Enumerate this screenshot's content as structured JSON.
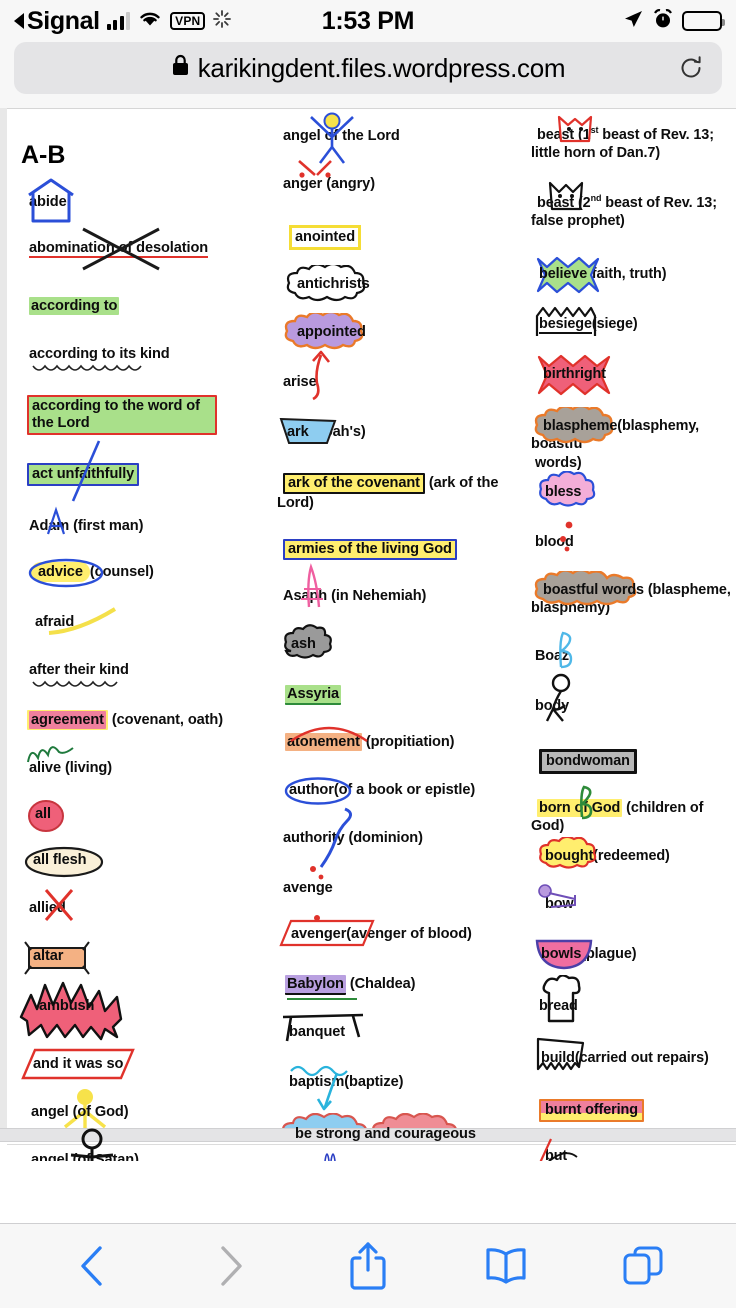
{
  "status_bar": {
    "carrier": "Signal",
    "back_arrow": "back-triangle",
    "signal_icon": "cellular-signal-icon",
    "wifi_icon": "wifi-icon",
    "vpn_badge": "VPN",
    "activity_icon": "activity-spinner-icon",
    "time": "1:53 PM",
    "location_icon": "location-arrow-icon",
    "alarm_icon": "alarm-clock-icon",
    "battery_icon": "battery-icon"
  },
  "url_bar": {
    "lock_icon": "lock-icon",
    "url": "karikingdent.files.wordpress.com",
    "reload_icon": "reload-icon"
  },
  "document": {
    "heading": "A-B",
    "columns": [
      {
        "id": "column-1",
        "entries": [
          {
            "term": "abide",
            "note": "",
            "style": "plain",
            "doodle": "house"
          },
          {
            "term": "abomination of desolation",
            "note": "",
            "style": "underline-red",
            "doodle": "x-cross"
          },
          {
            "term": "according to",
            "note": "",
            "style": "highlight-green",
            "doodle": "none"
          },
          {
            "term": "according to its kind",
            "note": "",
            "style": "squiggle-black",
            "doodle": "none"
          },
          {
            "term": "according to the word of the Lord",
            "note": "",
            "style": "highlight-green-box-red",
            "doodle": "none"
          },
          {
            "term": "act unfaithfully",
            "note": "",
            "style": "highlight-green-box-blue",
            "doodle": "blue-slash"
          },
          {
            "term": "Adam",
            "note": "(first man)",
            "style": "plain",
            "doodle": "blue-letter-a"
          },
          {
            "term": "advice",
            "note": "(counsel)",
            "style": "highlight-yellow-ellipse-blue",
            "doodle": "none"
          },
          {
            "term": "afraid",
            "note": "",
            "style": "plain",
            "doodle": "yellow-stroke"
          },
          {
            "term": "after their kind",
            "note": "",
            "style": "squiggle-black",
            "doodle": "none"
          },
          {
            "term": "agreement",
            "note": "(covenant, oath)",
            "style": "highlight-pink-box-yellow",
            "doodle": "none"
          },
          {
            "term": "alive",
            "note": "(living)",
            "style": "plain",
            "doodle": "green-squiggle"
          },
          {
            "term": "all",
            "note": "",
            "style": "blob-red",
            "doodle": "none"
          },
          {
            "term": "all flesh",
            "note": "",
            "style": "ellipse-black-cream",
            "doodle": "none"
          },
          {
            "term": "allied",
            "note": "",
            "style": "plain",
            "doodle": "red-x"
          },
          {
            "term": "altar",
            "note": "",
            "style": "highlight-orange-altar",
            "doodle": "none"
          },
          {
            "term": "ambush",
            "note": "",
            "style": "spiky-pink",
            "doodle": "none"
          },
          {
            "term": "and it was so",
            "note": "",
            "style": "parallelogram-red",
            "doodle": "none"
          },
          {
            "term": "angel (of God)",
            "note": "",
            "style": "plain",
            "doodle": "yellow-angel"
          },
          {
            "term": "angel (of Satan)",
            "note": "",
            "style": "plain",
            "doodle": "black-stickfigure"
          }
        ]
      },
      {
        "id": "column-2",
        "entries": [
          {
            "term": "angel of the Lord",
            "note": "",
            "style": "plain",
            "doodle": "blue-angel-stickfigure"
          },
          {
            "term": "anger (angry)",
            "note": "",
            "style": "plain",
            "doodle": "red-angry-brows"
          },
          {
            "term": "anointed",
            "note": "",
            "style": "box-yellow",
            "doodle": "none"
          },
          {
            "term": "antichrists",
            "note": "",
            "style": "cloud-black",
            "doodle": "none"
          },
          {
            "term": "appointed",
            "note": "",
            "style": "cloud-purple-orange",
            "doodle": "none"
          },
          {
            "term": "arise",
            "note": "",
            "style": "plain",
            "doodle": "red-up-arrow"
          },
          {
            "term": "ark",
            "note": "(Noah's)",
            "style": "highlight-blue-boat",
            "doodle": "none"
          },
          {
            "term": "ark of the covenant",
            "note": "(ark of the Lord)",
            "style": "highlight-yellow-box-black",
            "doodle": "none"
          },
          {
            "term": "armies of the living God",
            "note": "",
            "style": "highlight-yellow-box-blue",
            "doodle": "none"
          },
          {
            "term": "Asaph",
            "note": "(in Nehemiah)",
            "style": "plain",
            "doodle": "pink-harp"
          },
          {
            "term": "ash",
            "note": "",
            "style": "cloud-gray",
            "doodle": "none"
          },
          {
            "term": "Assyria",
            "note": "",
            "style": "highlight-green-underline-green",
            "doodle": "none"
          },
          {
            "term": "atonement",
            "note": "(propitiation)",
            "style": "highlight-orange-arc-red",
            "doodle": "none"
          },
          {
            "term": "author",
            "note": "(of a book or epistle)",
            "style": "ellipse-blue",
            "doodle": "none"
          },
          {
            "term": "authority (dominion)",
            "note": "",
            "style": "plain",
            "doodle": "blue-scepter"
          },
          {
            "term": "avenge",
            "note": "",
            "style": "plain",
            "doodle": "red-drips"
          },
          {
            "term": "avenger",
            "note": "(avenger of blood)",
            "style": "parallelogram-red",
            "doodle": "red-drop"
          },
          {
            "term": "Babylon",
            "note": "(Chaldea)",
            "style": "highlight-purple-underline-green",
            "doodle": "none"
          },
          {
            "term": "banquet",
            "note": "",
            "style": "table-black",
            "doodle": "none"
          },
          {
            "term": "baptism",
            "note": "(baptize)",
            "style": "plain",
            "doodle": "blue-wave-arrow"
          },
          {
            "term": "be strong and courageous",
            "note": "",
            "style": "cloud-blue-red",
            "doodle": "none"
          }
        ]
      },
      {
        "id": "column-3",
        "entries": [
          {
            "term": "beast (1st beast of Rev. 13; little horn of Dan.7)",
            "note": "",
            "style": "plain",
            "doodle": "red-beast-face",
            "sup": "st",
            "prefix": "beast (1",
            "suffix": " beast of Rev. 13; little horn of Dan.7)"
          },
          {
            "term": "beast (2nd beast of Rev. 13; false prophet)",
            "note": "",
            "style": "plain",
            "doodle": "black-beast-face",
            "sup": "nd",
            "prefix": "beast (2",
            "suffix": " beast of Rev. 13; false prophet)"
          },
          {
            "term": "believe",
            "note": "(faith, truth)",
            "style": "highlight-green-spiky-blue",
            "doodle": "none"
          },
          {
            "term": "besiege",
            "note": "(siege)",
            "style": "box-black-battlement",
            "doodle": "none"
          },
          {
            "term": "birthright",
            "note": "",
            "style": "spiky-red",
            "doodle": "none"
          },
          {
            "term": "blaspheme",
            "note": "(blasphemy, boastfu",
            "style": "cloud-gray-orange",
            "doodle": "none",
            "line2": "words)"
          },
          {
            "term": "bless",
            "note": "",
            "style": "cloud-pink-blue",
            "doodle": "none"
          },
          {
            "term": "blood",
            "note": "",
            "style": "plain",
            "doodle": "red-blood-drops"
          },
          {
            "term": "boastful words",
            "note": "(blaspheme, blasphemy)",
            "style": "cloud-gray-orange",
            "doodle": "none"
          },
          {
            "term": "Boaz",
            "note": "",
            "style": "plain",
            "doodle": "blue-letter-b"
          },
          {
            "term": "body",
            "note": "",
            "style": "plain",
            "doodle": "black-stickfigure-small"
          },
          {
            "term": "bondwoman",
            "note": "",
            "style": "highlight-gray-box-black",
            "doodle": "none"
          },
          {
            "term": "born of God",
            "note": "(children of God)",
            "style": "highlight-yellow-plain",
            "doodle": "green-letter-b"
          },
          {
            "term": "bought",
            "note": "(redeemed)",
            "style": "cloud-yellow-red",
            "doodle": "none"
          },
          {
            "term": "bow",
            "note": "",
            "style": "plain",
            "doodle": "purple-bow"
          },
          {
            "term": "bowls",
            "note": "(plague)",
            "style": "bowl-pink-purple",
            "doodle": "none"
          },
          {
            "term": "bread",
            "note": "",
            "style": "plain",
            "doodle": "black-bread-slice"
          },
          {
            "term": "build",
            "note": "(carried out repairs)",
            "style": "plain",
            "doodle": "black-saw"
          },
          {
            "term": "burnt offering",
            "note": "",
            "style": "highlight-pink-yellow-box-orange",
            "doodle": "none"
          },
          {
            "term": "but",
            "note": "",
            "style": "plain",
            "doodle": "red-angle"
          }
        ]
      }
    ]
  },
  "toolbar": {
    "back_label": "back-chevron-icon",
    "forward_label": "forward-chevron-icon",
    "share_label": "share-icon",
    "bookmarks_label": "bookmarks-icon",
    "tabs_label": "tabs-icon"
  },
  "colors": {
    "accent_blue": "#2a7ef5",
    "disabled_gray": "#b0b0b2",
    "chrome_bg": "#f7f7f7",
    "url_field": "#e4e4e6",
    "highlight_green": "#a9e08a",
    "highlight_yellow": "#ffee6e",
    "highlight_pink": "#ef7f9d",
    "highlight_purple": "#b9a0e0",
    "highlight_orange": "#f4b183",
    "highlight_blue": "#8ecdf0",
    "ink_red": "#e0322b",
    "ink_blue": "#2b3fc4"
  }
}
